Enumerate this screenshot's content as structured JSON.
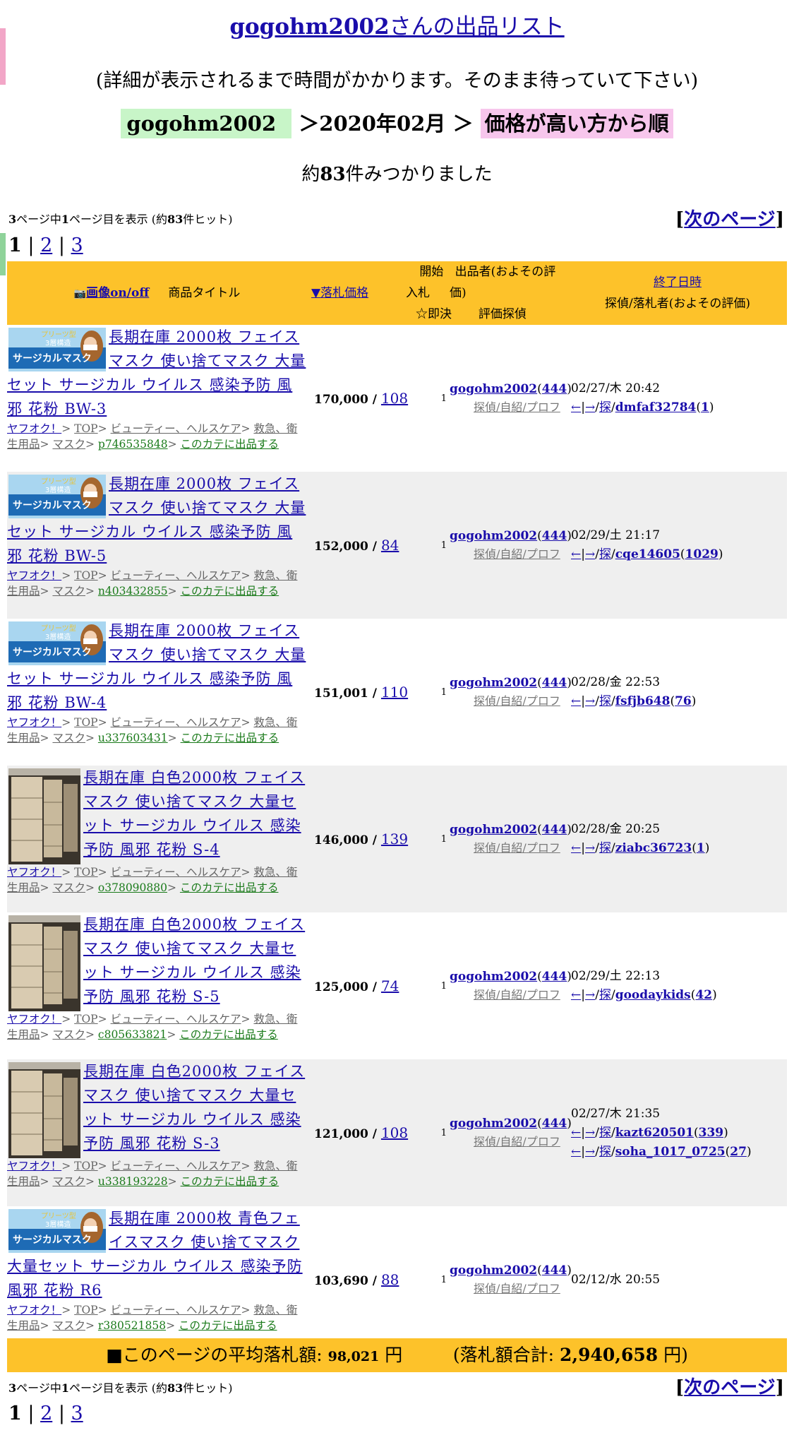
{
  "header": {
    "seller_id": "gogohm2002",
    "title_suffix": "さんの出品リスト",
    "wait_note": "(詳細が表示されるまで時間がかかります。そのまま待っていて下さい)",
    "crumb_user": "gogohm2002",
    "crumb_sep1": "＞",
    "crumb_month": "2020年02月",
    "crumb_sep2": "＞",
    "crumb_sort": "価格が高い方から順",
    "found_prefix": "約",
    "found_count": "83",
    "found_suffix": "件みつかりました"
  },
  "paging": {
    "info_a": "3",
    "info_b": "ページ中",
    "info_c": "1",
    "info_d": "ページ目を表示 (約",
    "info_e": "83",
    "info_f": "件ヒット)",
    "next_label": "次のページ",
    "bracket_l": "[",
    "bracket_r": "]",
    "pages": [
      "1",
      "2",
      "3"
    ],
    "sep": " | "
  },
  "table": {
    "col_image_toggle": "画像on/off",
    "col_title": "商品タイトル",
    "col_price_sort": "▼落札価格",
    "col_bids": "入札",
    "col_start": "開始",
    "col_buynow": "☆即決",
    "col_seller": "出品者(およその評価)",
    "col_seller_eval": "評価探偵",
    "col_end": "終了日時",
    "col_end_sub": "探偵/落札者(およその評価)"
  },
  "items": [
    {
      "thumb": "mask-banner",
      "title": "長期在庫 2000枚 フェイスマスク 使い捨てマスク 大量セット サージカル ウイルス 感染予防 風邪 花粉 BW-3",
      "price": "170,000",
      "bids": "108",
      "start": "1",
      "seller": "gogohm2002",
      "rating": "444",
      "cat_id": "p746535848",
      "end": "02/27/木 20:42",
      "bidders": [
        {
          "name": "dmfaf32784",
          "score": "1"
        }
      ]
    },
    {
      "thumb": "mask-banner",
      "title": "長期在庫 2000枚 フェイスマスク 使い捨てマスク 大量セット サージカル ウイルス 感染予防 風邪 花粉 BW-5",
      "price": "152,000",
      "bids": "84",
      "start": "1",
      "seller": "gogohm2002",
      "rating": "444",
      "cat_id": "n403432855",
      "end": "02/29/土 21:17",
      "bidders": [
        {
          "name": "cqe14605",
          "score": "1029"
        }
      ]
    },
    {
      "thumb": "mask-banner",
      "title": "長期在庫 2000枚 フェイスマスク 使い捨てマスク 大量セット サージカル ウイルス 感染予防 風邪 花粉 BW-4",
      "price": "151,001",
      "bids": "110",
      "start": "1",
      "seller": "gogohm2002",
      "rating": "444",
      "cat_id": "u337603431",
      "end": "02/28/金 22:53",
      "bidders": [
        {
          "name": "fsfjb648",
          "score": "76"
        }
      ]
    },
    {
      "thumb": "boxes-photo",
      "title": "長期在庫 白色2000枚 フェイスマスク 使い捨てマスク 大量セット サージカル ウイルス 感染予防 風邪 花粉 S-4",
      "price": "146,000",
      "bids": "139",
      "start": "1",
      "seller": "gogohm2002",
      "rating": "444",
      "cat_id": "o378090880",
      "end": "02/28/金 20:25",
      "bidders": [
        {
          "name": "ziabc36723",
          "score": "1"
        }
      ]
    },
    {
      "thumb": "boxes-photo",
      "title": "長期在庫 白色2000枚 フェイスマスク 使い捨てマスク 大量セット サージカル ウイルス 感染予防 風邪 花粉 S-5",
      "price": "125,000",
      "bids": "74",
      "start": "1",
      "seller": "gogohm2002",
      "rating": "444",
      "cat_id": "c805633821",
      "end": "02/29/土 22:13",
      "bidders": [
        {
          "name": "goodaykids",
          "score": "42"
        }
      ]
    },
    {
      "thumb": "boxes-photo",
      "title": "長期在庫 白色2000枚 フェイスマスク 使い捨てマスク 大量セット サージカル ウイルス 感染予防 風邪 花粉 S-3",
      "price": "121,000",
      "bids": "108",
      "start": "1",
      "seller": "gogohm2002",
      "rating": "444",
      "cat_id": "u338193228",
      "end": "02/27/木 21:35",
      "bidders": [
        {
          "name": "kazt620501",
          "score": "339"
        },
        {
          "name": "soha_1017_0725",
          "score": "27"
        }
      ]
    },
    {
      "thumb": "mask-banner",
      "title": "長期在庫 2000枚 青色フェイスマスク 使い捨てマスク 大量セット サージカル ウイルス 感染予防 風邪 花粉 R6",
      "price": "103,690",
      "bids": "88",
      "start": "1",
      "seller": "gogohm2002",
      "rating": "444",
      "cat_id": "r380521858",
      "end": "02/12/水 20:55",
      "bidders": []
    }
  ],
  "category": {
    "yafuoku": "ヤフオク！",
    "gt": ">",
    "top": "TOP",
    "beauty": "ビューティー、ヘルスケア",
    "firstaid": "救急、衛生用品",
    "mask": "マスク",
    "this_cat": "このカテに出品する"
  },
  "seller_links": {
    "tantei": "探偵",
    "self": "自紹",
    "prof": "プロフ",
    "slash": "/"
  },
  "end_links": {
    "prev": "←",
    "next": "→",
    "tantei": "探"
  },
  "currency_label": "",
  "banner_text": {
    "line1": "プリーツ型",
    "line2": "3層構造",
    "line3": "サージカルマスク"
  },
  "summary": {
    "avg_label": "■このページの平均落札額:",
    "avg_value": "98,021",
    "yen": "円",
    "total_label": "(落札額合計:",
    "total_value": "2,940,658",
    "total_yen": "円)"
  },
  "colors": {
    "header_bg": "#fdc22a",
    "link": "#1a0dab",
    "crumb_user_bg": "#c8f5c8",
    "crumb_sort_bg": "#f7c6ec",
    "alt_row": "#efefef"
  }
}
